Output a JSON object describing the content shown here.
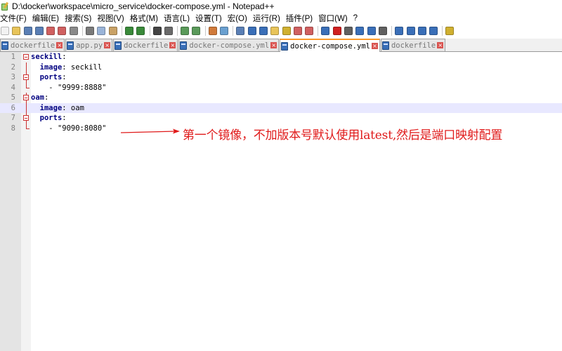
{
  "window": {
    "title": "D:\\docker\\workspace\\micro_service\\docker-compose.yml - Notepad++"
  },
  "menu": [
    "文件(F)",
    "编辑(E)",
    "搜索(S)",
    "视图(V)",
    "格式(M)",
    "语言(L)",
    "设置(T)",
    "宏(O)",
    "运行(R)",
    "插件(P)",
    "窗口(W)",
    "?"
  ],
  "toolbar": {
    "icons": [
      {
        "name": "new-file-icon",
        "color": "#f2f2f2"
      },
      {
        "name": "open-file-icon",
        "color": "#e8c45a"
      },
      {
        "name": "save-icon",
        "color": "#5a7fb5"
      },
      {
        "name": "save-all-icon",
        "color": "#5a7fb5"
      },
      {
        "name": "close-icon",
        "color": "#d06060"
      },
      {
        "name": "close-all-icon",
        "color": "#d06060"
      },
      {
        "name": "print-icon",
        "color": "#8a8a8a"
      },
      {
        "name": "cut-icon",
        "color": "#7a7a7a"
      },
      {
        "name": "copy-icon",
        "color": "#9ab4d8"
      },
      {
        "name": "paste-icon",
        "color": "#c9a266"
      },
      {
        "name": "undo-icon",
        "color": "#3a8a3a"
      },
      {
        "name": "redo-icon",
        "color": "#3a8a3a"
      },
      {
        "name": "find-icon",
        "color": "#444444"
      },
      {
        "name": "replace-icon",
        "color": "#6a6a6a"
      },
      {
        "name": "zoom-in-icon",
        "color": "#5a9a5a"
      },
      {
        "name": "zoom-out-icon",
        "color": "#5a9a5a"
      },
      {
        "name": "sync-vertical-icon",
        "color": "#d07a3a"
      },
      {
        "name": "sync-horizontal-icon",
        "color": "#6aa0d0"
      },
      {
        "name": "word-wrap-icon",
        "color": "#5a7fb5"
      },
      {
        "name": "show-all-chars-icon",
        "color": "#3a6fb8"
      },
      {
        "name": "indent-guide-icon",
        "color": "#3a6fb8"
      },
      {
        "name": "doc-map-icon",
        "color": "#e8c45a"
      },
      {
        "name": "function-list-icon",
        "color": "#d0b030"
      },
      {
        "name": "folder-as-workspace-icon",
        "color": "#d06060"
      },
      {
        "name": "doc-list-icon",
        "color": "#d06060"
      },
      {
        "name": "monitoring-icon",
        "color": "#3a6fb8"
      },
      {
        "name": "record-macro-icon",
        "color": "#d02020"
      },
      {
        "name": "stop-record-icon",
        "color": "#606060"
      },
      {
        "name": "playback-macro-icon",
        "color": "#3a6fb8"
      },
      {
        "name": "run-macro-multiple-icon",
        "color": "#3a6fb8"
      },
      {
        "name": "save-macro-icon",
        "color": "#606060"
      },
      {
        "name": "sort-lines-icon",
        "color": "#3a6fb8"
      },
      {
        "name": "move-up-icon",
        "color": "#3a6fb8"
      },
      {
        "name": "move-down-icon",
        "color": "#3a6fb8"
      },
      {
        "name": "triangle-down-icon",
        "color": "#3a6fb8"
      },
      {
        "name": "plugin-icon",
        "color": "#d0b030"
      }
    ]
  },
  "tabs": [
    {
      "label": "dockerfile",
      "active": false
    },
    {
      "label": "app.py",
      "active": false
    },
    {
      "label": "dockerfile",
      "active": false
    },
    {
      "label": "docker-compose.yml",
      "active": false
    },
    {
      "label": "docker-compose.yml",
      "active": true
    },
    {
      "label": "dockerfile",
      "active": false
    }
  ],
  "editor": {
    "lines": [
      {
        "num": "1",
        "indent": "",
        "key": "seckill",
        "sep": ":",
        "value": "",
        "fold": "start"
      },
      {
        "num": "2",
        "indent": "  ",
        "key": "image",
        "sep": ": ",
        "value": "seckill",
        "fold": "line"
      },
      {
        "num": "3",
        "indent": "  ",
        "key": "ports",
        "sep": ":",
        "value": "",
        "fold": "start"
      },
      {
        "num": "4",
        "indent": "    ",
        "key": "",
        "sep": "",
        "value": "- \"9999:8888\"",
        "fold": "end"
      },
      {
        "num": "5",
        "indent": "",
        "key": "oam",
        "sep": ":",
        "value": "",
        "fold": "start"
      },
      {
        "num": "6",
        "indent": "  ",
        "key": "image",
        "sep": ": ",
        "value": "oam",
        "fold": "line",
        "current": true
      },
      {
        "num": "7",
        "indent": "  ",
        "key": "ports",
        "sep": ":",
        "value": "",
        "fold": "start"
      },
      {
        "num": "8",
        "indent": "    ",
        "key": "",
        "sep": "",
        "value": "- \"9090:8080\"",
        "fold": "end"
      }
    ]
  },
  "annotation": {
    "text": "第一个镜像，不加版本号默认使用latest,然后是端口映射配置",
    "color": "#e01a1a"
  }
}
